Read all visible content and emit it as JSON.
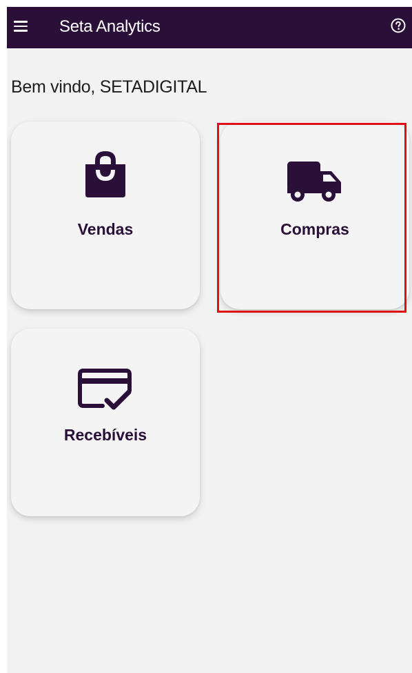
{
  "appbar": {
    "title": "Seta Analytics",
    "menu_icon": "hamburger-menu-icon",
    "help_icon": "help-circle-icon",
    "background_color": "#2a0f38"
  },
  "welcome_text": "Bem vindo, SETADIGITAL",
  "cards": [
    {
      "label": "Vendas",
      "icon": "shopping-bag-icon"
    },
    {
      "label": "Compras",
      "icon": "delivery-truck-icon",
      "highlighted": true
    },
    {
      "label": "Recebíveis",
      "icon": "credit-card-check-icon"
    }
  ],
  "colors": {
    "accent": "#2a0f38",
    "background": "#f2f2f2",
    "highlight": "#e01010"
  }
}
